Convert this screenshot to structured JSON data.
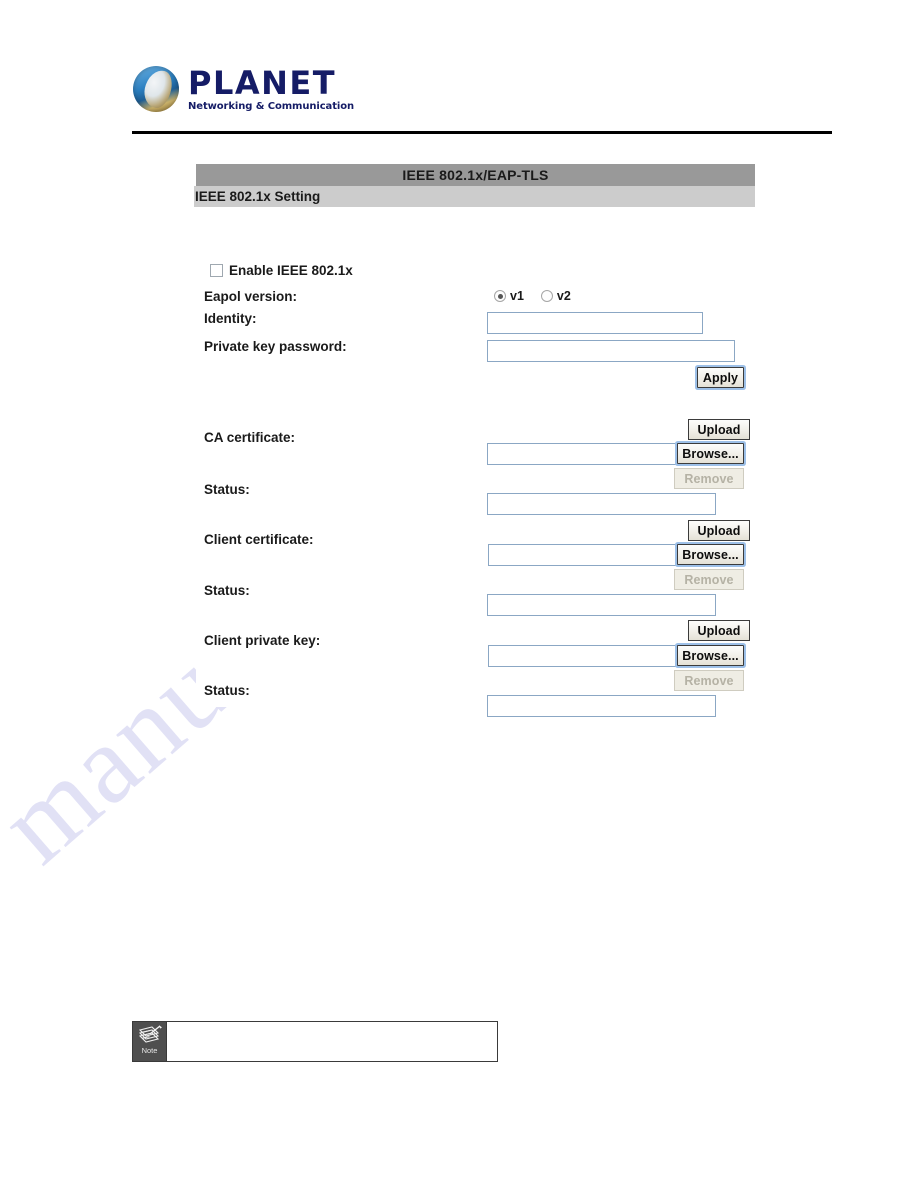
{
  "brand": {
    "name": "PLANET",
    "tagline": "Networking & Communication",
    "logo_icon": "planet-globe-icon",
    "word_color": "#151c66"
  },
  "watermark": {
    "text": "manualshive.com",
    "color": "#c9c9ee"
  },
  "panel": {
    "title": "IEEE 802.1x/EAP-TLS",
    "subtitle": "IEEE 802.1x Setting",
    "title_bg": "#999999",
    "subtitle_bg": "#cccccc"
  },
  "form": {
    "enable_checkbox": {
      "label": "Enable IEEE 802.1x",
      "checked": false
    },
    "eapol": {
      "label": "Eapol version:",
      "options": [
        {
          "label": "v1",
          "selected": true
        },
        {
          "label": "v2",
          "selected": false
        }
      ]
    },
    "identity": {
      "label": "Identity:",
      "value": "",
      "placeholder": ""
    },
    "private_key_password": {
      "label": "Private key password:",
      "value": "",
      "placeholder": ""
    },
    "apply_button": "Apply",
    "ca_certificate": {
      "label": "CA certificate:",
      "file_value": "",
      "upload_label": "Upload",
      "browse_label": "Browse...",
      "remove_label": "Remove",
      "remove_disabled": true,
      "status_label": "Status:",
      "status_value": ""
    },
    "client_certificate": {
      "label": "Client certificate:",
      "file_value": "",
      "upload_label": "Upload",
      "browse_label": "Browse...",
      "remove_label": "Remove",
      "remove_disabled": true,
      "status_label": "Status:",
      "status_value": ""
    },
    "client_private_key": {
      "label": "Client private key:",
      "file_value": "",
      "upload_label": "Upload",
      "browse_label": "Browse...",
      "remove_label": "Remove",
      "remove_disabled": true,
      "status_label": "Status:",
      "status_value": ""
    }
  },
  "note": {
    "icon": "note-pencil-icon",
    "icon_label": "Note",
    "text": ""
  }
}
